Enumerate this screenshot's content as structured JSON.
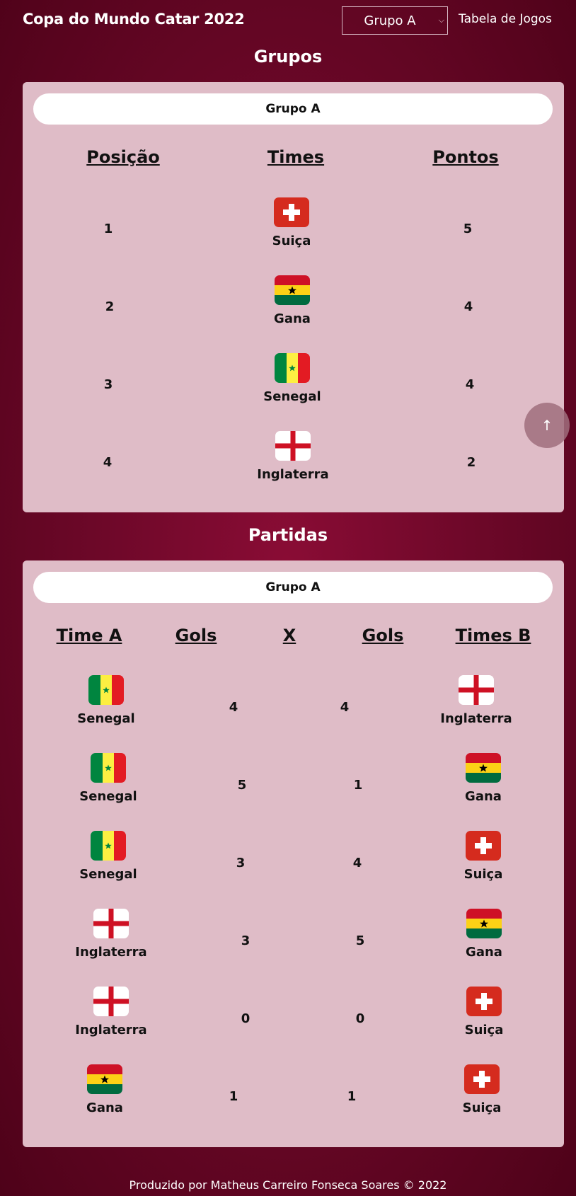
{
  "header": {
    "title": "Copa do Mundo Catar 2022",
    "group_select": {
      "value": "Grupo A"
    },
    "nav_link": "Tabela de Jogos"
  },
  "groups": {
    "title": "Grupos",
    "group_name": "Grupo A",
    "headers": {
      "position": "Posição",
      "teams": "Times",
      "points": "Pontos"
    },
    "rows": [
      {
        "position": "1",
        "team": "Suiça",
        "flag": "switzerland-flag-icon",
        "points": "5"
      },
      {
        "position": "2",
        "team": "Gana",
        "flag": "ghana-flag-icon",
        "points": "4"
      },
      {
        "position": "3",
        "team": "Senegal",
        "flag": "senegal-flag-icon",
        "points": "4"
      },
      {
        "position": "4",
        "team": "Inglaterra",
        "flag": "england-flag-icon",
        "points": "2"
      }
    ]
  },
  "matches": {
    "title": "Partidas",
    "group_name": "Grupo A",
    "headers": {
      "team_a": "Time A",
      "goals_a": "Gols",
      "x": "X",
      "goals_b": "Gols",
      "team_b": "Times B"
    },
    "rows": [
      {
        "team_a": "Senegal",
        "flag_a": "senegal-flag-icon",
        "goals_a": "4",
        "goals_b": "4",
        "team_b": "Inglaterra",
        "flag_b": "england-flag-icon"
      },
      {
        "team_a": "Senegal",
        "flag_a": "senegal-flag-icon",
        "goals_a": "5",
        "goals_b": "1",
        "team_b": "Gana",
        "flag_b": "ghana-flag-icon"
      },
      {
        "team_a": "Senegal",
        "flag_a": "senegal-flag-icon",
        "goals_a": "3",
        "goals_b": "4",
        "team_b": "Suiça",
        "flag_b": "switzerland-flag-icon"
      },
      {
        "team_a": "Inglaterra",
        "flag_a": "england-flag-icon",
        "goals_a": "3",
        "goals_b": "5",
        "team_b": "Gana",
        "flag_b": "ghana-flag-icon"
      },
      {
        "team_a": "Inglaterra",
        "flag_a": "england-flag-icon",
        "goals_a": "0",
        "goals_b": "0",
        "team_b": "Suiça",
        "flag_b": "switzerland-flag-icon"
      },
      {
        "team_a": "Gana",
        "flag_a": "ghana-flag-icon",
        "goals_a": "1",
        "goals_b": "1",
        "team_b": "Suiça",
        "flag_b": "switzerland-flag-icon"
      }
    ]
  },
  "scroll_top": {
    "label": "↑",
    "icon": "arrow-up-icon"
  },
  "footer": {
    "text": "Produzido por Matheus Carreiro Fonseca Soares © 2022"
  },
  "colors": {
    "background": "#6e0829",
    "panel": "#dfbcc7",
    "pill": "#ffffff",
    "text": "#111111"
  }
}
